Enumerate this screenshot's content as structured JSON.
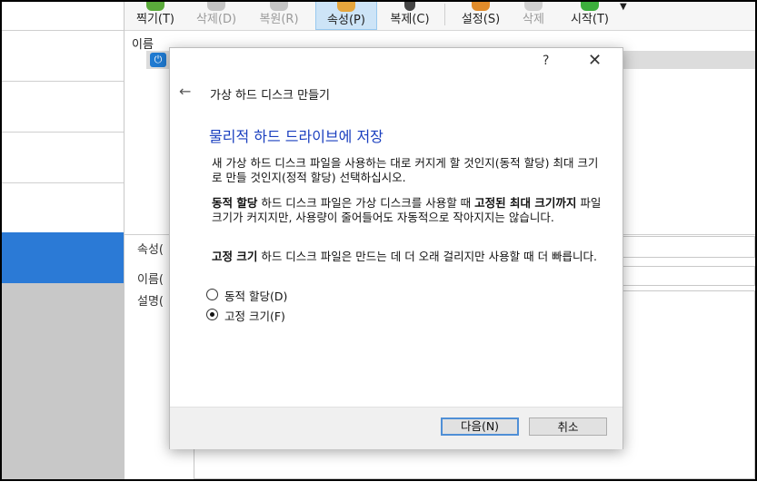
{
  "toolbar": {
    "items": [
      {
        "label": "찍기(T)",
        "icon": "snapshot-icon",
        "color": "#5aaa3a"
      },
      {
        "label": "삭제(D)",
        "icon": "delete-icon",
        "color": "#b8b8b8"
      },
      {
        "label": "복원(R)",
        "icon": "restore-icon",
        "color": "#b8b8b8"
      },
      {
        "label": "속성(P)",
        "icon": "properties-icon",
        "color": "#e5a53c"
      },
      {
        "label": "복제(C)",
        "icon": "clone-icon",
        "color": "#444444"
      },
      {
        "label": "설정(S)",
        "icon": "settings-icon",
        "color": "#e08b2a"
      },
      {
        "label": "삭제",
        "icon": "discard-icon",
        "color": "#b8b8b8"
      },
      {
        "label": "시작(T)",
        "icon": "start-icon",
        "color": "#3cae3c"
      }
    ],
    "dropdown_glyph": "▼"
  },
  "main": {
    "name_header": "이름",
    "vm_power_glyph": "⏻",
    "details": {
      "attributes_label": "속성(",
      "name_label": "이름(",
      "description_label": "설명("
    }
  },
  "dialog": {
    "help": "?",
    "close": "✕",
    "back": "←",
    "title": "가상 하드 디스크 만들기",
    "heading": "물리적 하드 드라이브에 저장",
    "intro": "새 가상 하드 디스크 파일을 사용하는 대로 커지게 할 것인지(동적 할당) 최대 크기로 만들 것인지(정적 할당) 선택하십시오.",
    "dynamic_bold": "동적 할당",
    "dynamic_text_1": " 하드 디스크 파일은 가상 디스크를 사용할 때 ",
    "dynamic_bold_2": "고정된 최대 크기까지",
    "dynamic_text_2": " 파일 크기가 커지지만, 사용량이 줄어들어도 자동적으로 작아지지는 않습니다.",
    "fixed_bold": "고정 크기",
    "fixed_text": " 하드 디스크 파일은 만드는 데 더 오래 걸리지만 사용할 때 더 빠릅니다.",
    "options": [
      {
        "label": "동적 할당(D)",
        "selected": false
      },
      {
        "label": "고정 크기(F)",
        "selected": true
      }
    ],
    "next_button": "다음(N)",
    "cancel_button": "취소"
  }
}
